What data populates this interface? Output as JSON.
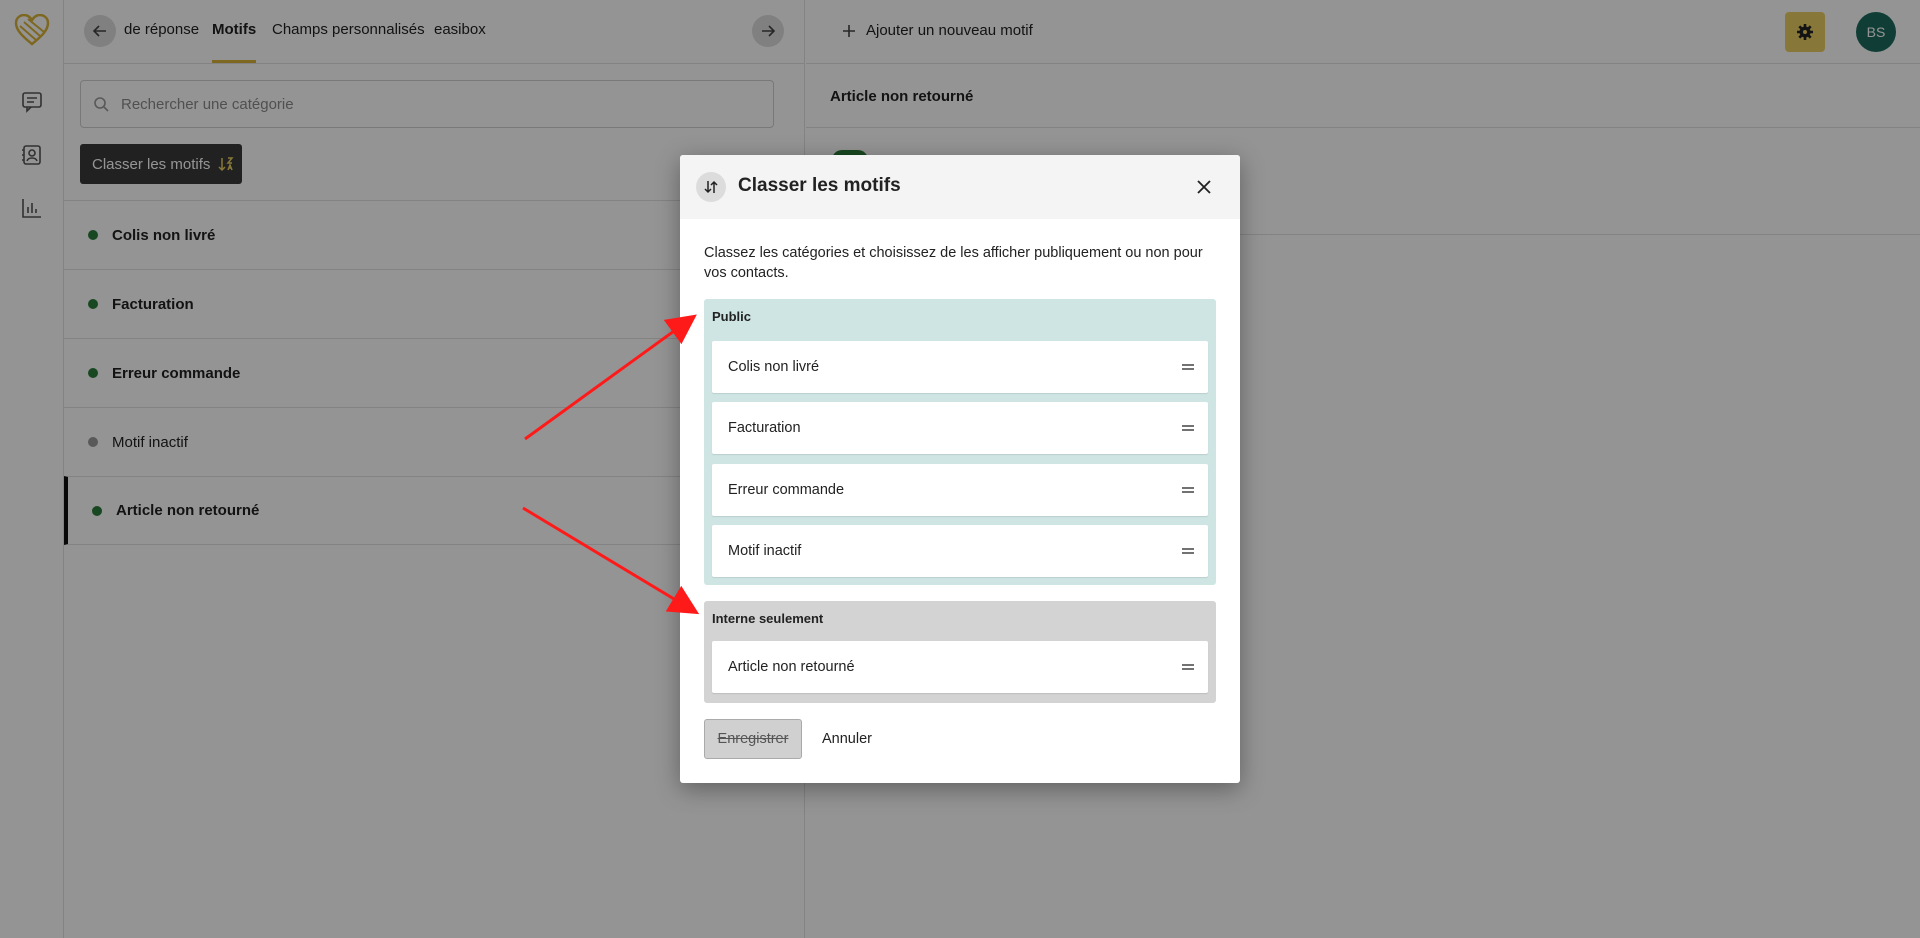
{
  "rail": {
    "logo_color": "#d9b43a",
    "nav_items": [
      {
        "icon": "chat-icon"
      },
      {
        "icon": "contacts-icon"
      },
      {
        "icon": "stats-icon"
      }
    ]
  },
  "left_panel": {
    "tabs": [
      {
        "label": "de réponse",
        "active": false
      },
      {
        "label": "Motifs",
        "active": true
      },
      {
        "label": "Champs personnalisés",
        "active": false
      },
      {
        "label": "easibox",
        "active": false
      }
    ],
    "search_placeholder": "Rechercher une catégorie",
    "sort_button_label": "Classer les motifs",
    "items": [
      {
        "label": "Colis non livré",
        "status": "active",
        "bold": true,
        "selected": false
      },
      {
        "label": "Facturation",
        "status": "active",
        "bold": true,
        "selected": false
      },
      {
        "label": "Erreur commande",
        "status": "active",
        "bold": true,
        "selected": false
      },
      {
        "label": "Motif inactif",
        "status": "inactive",
        "bold": false,
        "selected": false
      },
      {
        "label": "Article non retourné",
        "status": "active",
        "bold": true,
        "selected": true
      }
    ]
  },
  "right_panel": {
    "add_label": "Ajouter un nouveau motif",
    "title": "Article non retourné",
    "avatar_initials": "BS",
    "accent_color": "#e9cf62",
    "avatar_color": "#1c6a5e"
  },
  "modal": {
    "title": "Classer les motifs",
    "description": "Classez les catégories et choisissez de les afficher publiquement ou non pour vos contacts.",
    "groups": [
      {
        "label": "Public",
        "items": [
          "Colis non livré",
          "Facturation",
          "Erreur commande",
          "Motif inactif"
        ]
      },
      {
        "label": "Interne seulement",
        "items": [
          "Article non retourné"
        ]
      }
    ],
    "save_label": "Enregistrer",
    "cancel_label": "Annuler"
  }
}
